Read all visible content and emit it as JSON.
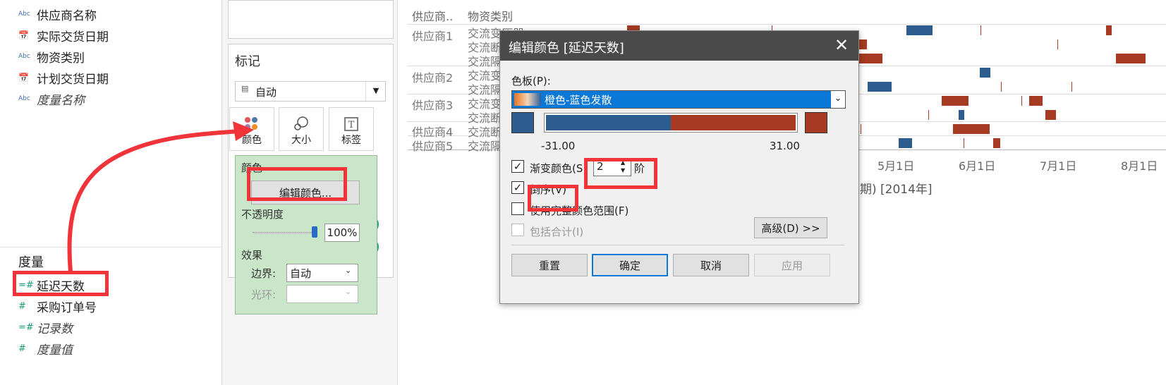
{
  "left_pane": {
    "dimensions": [
      {
        "icon": "Abc",
        "label": "供应商名称",
        "italic": false
      },
      {
        "icon": "calendar",
        "label": "实际交货日期",
        "italic": false
      },
      {
        "icon": "Abc",
        "label": "物资类别",
        "italic": false
      },
      {
        "icon": "calendar",
        "label": "计划交货日期",
        "italic": false
      },
      {
        "icon": "Abc",
        "label": "度量名称",
        "italic": true
      }
    ],
    "measures_header": "度量",
    "measures": [
      {
        "icon": "=#",
        "label": "延迟天数",
        "italic": false
      },
      {
        "icon": "#",
        "label": "采购订单号",
        "italic": false
      },
      {
        "icon": "=#",
        "label": "记录数",
        "italic": true
      },
      {
        "icon": "#",
        "label": "度量值",
        "italic": true
      }
    ]
  },
  "marks_card": {
    "title": "标记",
    "mark_type": "自动",
    "buttons": [
      {
        "label": "颜色"
      },
      {
        "label": "大小"
      },
      {
        "label": "标签"
      }
    ]
  },
  "color_popup": {
    "section_color": "颜色",
    "edit_color_button": "编辑颜色...",
    "opacity_label": "不透明度",
    "opacity_value": "100%",
    "opacity_fraction": 1.0,
    "effects_label": "效果",
    "border_label": "边界:",
    "border_value": "自动",
    "halo_label": "光环:",
    "halo_value": ""
  },
  "view": {
    "header_supplier": "供应商..",
    "header_category": "物资类别",
    "suppliers": [
      "供应商1",
      "供应商2",
      "供应商3",
      "供应商4",
      "供应商5"
    ],
    "categories": [
      "交流变压器",
      "交流断",
      "交流隔",
      "交流变",
      "交流隔",
      "交流变",
      "交流断",
      "交流断",
      "交流隔"
    ],
    "axis_ticks": [
      "5月1日",
      "6月1日",
      "7月1日",
      "8月1日"
    ],
    "axis_title": "期) [2014年]",
    "colors": {
      "blue": "#2d5c8e",
      "orange": "#a63a22"
    }
  },
  "dialog": {
    "title": "编辑颜色 [延迟天数]",
    "palette_label": "色板(P):",
    "palette_value": "橙色-蓝色发散",
    "range_min": "-31.00",
    "range_max": "31.00",
    "stepped_label": "渐变颜色(S)",
    "stepped_value": "2",
    "stepped_unit": "阶",
    "stepped_checked": true,
    "reverse_label": "倒序(V)",
    "reverse_checked": true,
    "full_range_label": "使用完整颜色范围(F)",
    "full_range_checked": false,
    "include_totals_label": "包括合计(I)",
    "include_totals_checked": false,
    "advanced_button": "高级(D) >>",
    "buttons": {
      "reset": "重置",
      "ok": "确定",
      "cancel": "取消",
      "apply": "应用"
    },
    "colors": {
      "left": "#2d5c8e",
      "right": "#a63a22",
      "split_fraction": 0.5
    }
  }
}
